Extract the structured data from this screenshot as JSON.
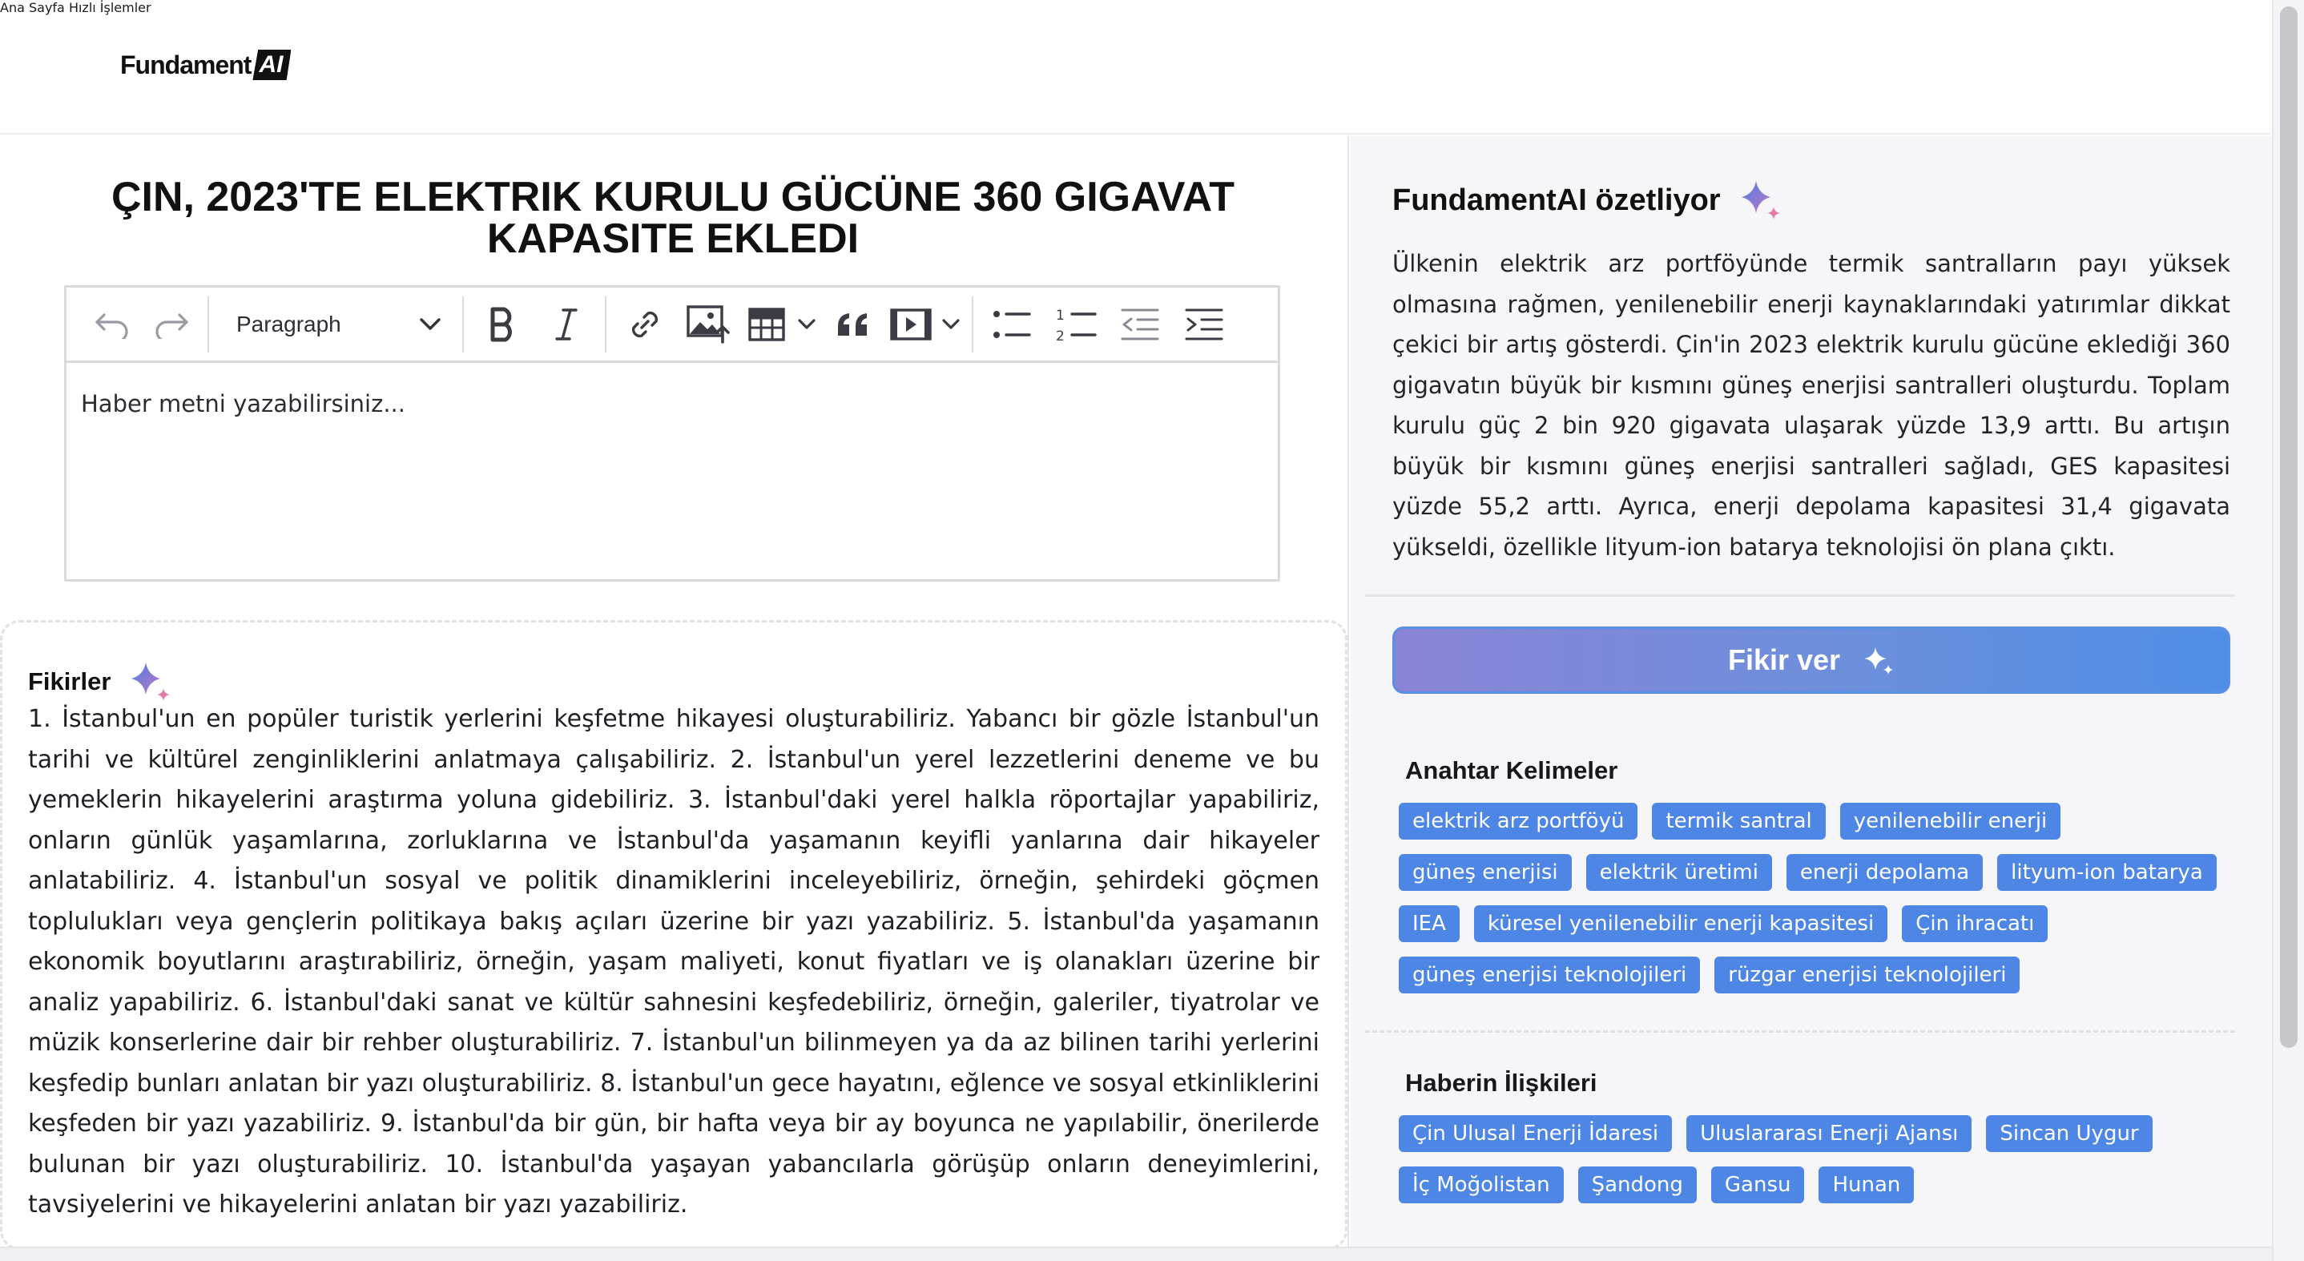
{
  "brand": {
    "logo_text": "Fundament",
    "logo_ai": "AI"
  },
  "nav": {
    "home": "Ana Sayfa",
    "quick_actions": "Hızlı İşlemler"
  },
  "article": {
    "title": "ÇIN, 2023'TE ELEKTRIK KURULU GÜCÜNE 360 GIGAVAT KAPASITE EKLEDI"
  },
  "editor": {
    "block_format": "Paragraph",
    "placeholder": "Haber metni yazabilirsiniz...",
    "toolbar_icons": [
      "undo-icon",
      "redo-icon",
      "bold-icon",
      "italic-icon",
      "link-icon",
      "image-upload-icon",
      "table-icon",
      "blockquote-icon",
      "media-icon",
      "bulleted-list-icon",
      "numbered-list-icon",
      "outdent-icon",
      "indent-icon"
    ]
  },
  "ideas": {
    "title": "Fikirler",
    "text": "1. İstanbul'un en popüler turistik yerlerini keşfetme hikayesi oluşturabiliriz. Yabancı bir gözle İstanbul'un tarihi ve kültürel zenginliklerini anlatmaya çalışabiliriz. 2. İstanbul'un yerel lezzetlerini deneme ve bu yemeklerin hikayelerini araştırma yoluna gidebiliriz. 3. İstanbul'daki yerel halkla röportajlar yapabiliriz, onların günlük yaşamlarına, zorluklarına ve İstanbul'da yaşamanın keyifli yanlarına dair hikayeler anlatabiliriz. 4. İstanbul'un sosyal ve politik dinamiklerini inceleyebiliriz, örneğin, şehirdeki göçmen toplulukları veya gençlerin politikaya bakış açıları üzerine bir yazı yazabiliriz. 5. İstanbul'da yaşamanın ekonomik boyutlarını araştırabiliriz, örneğin, yaşam maliyeti, konut fiyatları ve iş olanakları üzerine bir analiz yapabiliriz. 6. İstanbul'daki sanat ve kültür sahnesini keşfedebiliriz, örneğin, galeriler, tiyatrolar ve müzik konserlerine dair bir rehber oluşturabiliriz. 7. İstanbul'un bilinmeyen ya da az bilinen tarihi yerlerini keşfedip bunları anlatan bir yazı oluşturabiliriz. 8. İstanbul'un gece hayatını, eğlence ve sosyal etkinliklerini keşfeden bir yazı yazabiliriz. 9. İstanbul'da bir gün, bir hafta veya bir ay boyunca ne yapılabilir, önerilerde bulunan bir yazı oluşturabiliriz. 10. İstanbul'da yaşayan yabancılarla görüşüp onların deneyimlerini, tavsiyelerini ve hikayelerini anlatan bir yazı yazabiliriz."
  },
  "summary": {
    "title": "FundamentAI özetliyor",
    "text": "Ülkenin elektrik arz portföyünde termik santralların payı yüksek olmasına rağmen, yenilenebilir enerji kaynaklarındaki yatırımlar dikkat çekici bir artış gösterdi. Çin'in 2023 elektrik kurulu gücüne eklediği 360 gigavatın büyük bir kısmını güneş enerjisi santralleri oluşturdu. Toplam kurulu güç 2 bin 920 gigavata ulaşarak yüzde 13,9 arttı. Bu artışın büyük bir kısmını güneş enerjisi santralleri sağladı, GES kapasitesi yüzde 55,2 arttı. Ayrıca, enerji depolama kapasitesi 31,4 gigavata yükseldi, özellikle lityum-ion batarya teknolojisi ön plana çıktı."
  },
  "idea_button": {
    "label": "Fikir ver"
  },
  "keywords": {
    "title": "Anahtar Kelimeler",
    "items": [
      "elektrik arz portföyü",
      "termik santral",
      "yenilenebilir enerji",
      "güneş enerjisi",
      "elektrik üretimi",
      "enerji depolama",
      "lityum-ion batarya",
      "IEA",
      "küresel yenilenebilir enerji kapasitesi",
      "Çin ihracatı",
      "güneş enerjisi teknolojileri",
      "rüzgar enerjisi teknolojileri"
    ]
  },
  "relations": {
    "title": "Haberin İlişkileri",
    "items": [
      "Çin Ulusal Enerji İdaresi",
      "Uluslararası Enerji Ajansı",
      "Sincan Uygur",
      "İç Moğolistan",
      "Şandong",
      "Gansu",
      "Hunan"
    ]
  },
  "colors": {
    "tag_bg": "#4e86e6",
    "button_gradient_start": "#8a84d6",
    "button_gradient_end": "#4f8ee6",
    "sparkle_blue": "#5a7fe0",
    "sparkle_pink": "#e57aa6"
  }
}
